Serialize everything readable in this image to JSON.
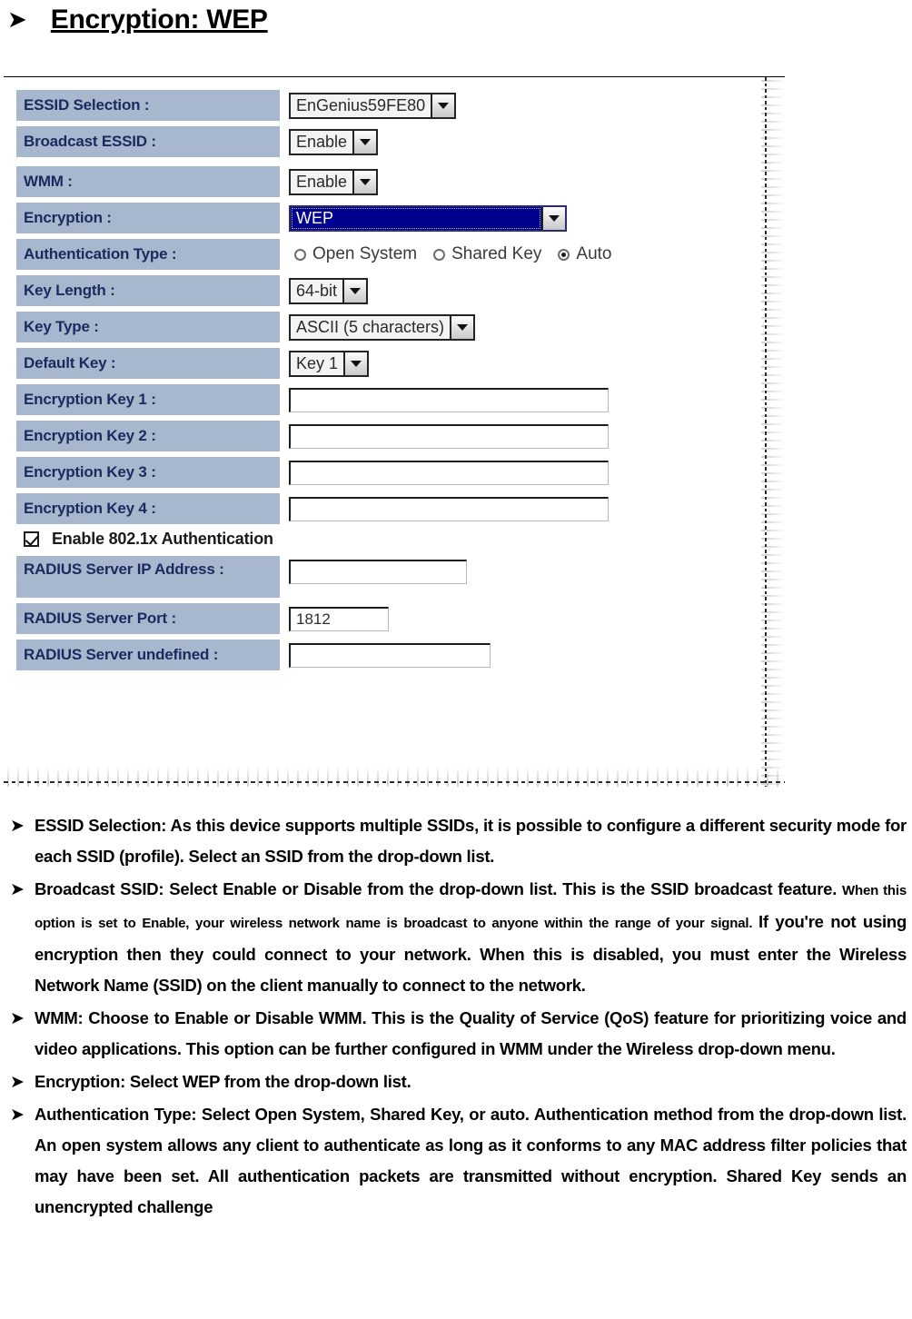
{
  "heading": {
    "bullet": "➤",
    "text": "Encryption: WEP"
  },
  "screenshot": {
    "rows": [
      {
        "label": "ESSID Selection :",
        "control": "select",
        "value": "EnGenius59FE80"
      },
      {
        "label": "Broadcast ESSID :",
        "control": "select",
        "value": "Enable"
      },
      {
        "label": "WMM :",
        "control": "select",
        "value": "Enable"
      },
      {
        "label": "Encryption :",
        "control": "select-focused",
        "value": "WEP"
      },
      {
        "label": "Authentication Type :",
        "control": "radio-group"
      },
      {
        "label": "Key Length :",
        "control": "select",
        "value": "64-bit"
      },
      {
        "label": "Key Type :",
        "control": "select",
        "value": "ASCII (5 characters)"
      },
      {
        "label": "Default Key :",
        "control": "select",
        "value": "Key 1"
      },
      {
        "label": "Encryption Key 1 :",
        "control": "text",
        "value": ""
      },
      {
        "label": "Encryption Key 2 :",
        "control": "text",
        "value": ""
      },
      {
        "label": "Encryption Key 3 :",
        "control": "text",
        "value": ""
      },
      {
        "label": "Encryption Key 4 :",
        "control": "text",
        "value": ""
      },
      {
        "label": "RADIUS Server IP Address :",
        "control": "text",
        "value": ""
      },
      {
        "label": "RADIUS Server Port :",
        "control": "text",
        "value": "1812"
      },
      {
        "label": "RADIUS Server undefined :",
        "control": "text",
        "value": ""
      }
    ],
    "auth_radios": [
      {
        "label": "Open System",
        "selected": false
      },
      {
        "label": "Shared Key",
        "selected": false
      },
      {
        "label": "Auto",
        "selected": true
      }
    ],
    "dot1x_checkbox": {
      "label": "Enable 802.1x Authentication",
      "checked": true
    },
    "labels": {
      "essid_selection": "ESSID Selection :",
      "broadcast_essid": "Broadcast ESSID :",
      "wmm": "WMM :",
      "encryption": "Encryption :",
      "authentication_type": "Authentication Type :",
      "key_length": "Key Length :",
      "key_type": "Key Type :",
      "default_key": "Default Key :",
      "enc_key_1": "Encryption Key 1 :",
      "enc_key_2": "Encryption Key 2 :",
      "enc_key_3": "Encryption Key 3 :",
      "enc_key_4": "Encryption Key 4 :",
      "radius_ip": "RADIUS Server IP Address :",
      "radius_port": "RADIUS Server Port :",
      "radius_undefined": "RADIUS Server undefined :"
    },
    "values": {
      "essid_selection": "EnGenius59FE80",
      "broadcast_essid": "Enable",
      "wmm": "Enable",
      "encryption": "WEP",
      "key_length": "64-bit",
      "key_type": "ASCII (5 characters)",
      "default_key": "Key 1",
      "enc_key_1": "",
      "enc_key_2": "",
      "enc_key_3": "",
      "enc_key_4": "",
      "radius_ip": "",
      "radius_port": "1812",
      "radius_undefined": ""
    }
  },
  "bullets": [
    {
      "arrow": "➤",
      "parts": [
        {
          "size": "normal",
          "text": "ESSID Selection: As this device supports multiple SSIDs, it is possible to configure a different security mode for each SSID (profile). Select an SSID from the drop-down list."
        }
      ]
    },
    {
      "arrow": "➤",
      "parts": [
        {
          "size": "normal",
          "text": "Broadcast SSID: Select Enable or Disable from the drop-down list. This is the SSID broadcast feature. "
        },
        {
          "size": "small",
          "text": "When this option is set to Enable, your wireless network name is broadcast to anyone within the range of your signal. "
        },
        {
          "size": "normal",
          "text": "If you're not using encryption then they could connect to your network. When this is disabled, you must enter the Wireless Network Name (SSID) on the client manually to connect to the network."
        }
      ]
    },
    {
      "arrow": "➤",
      "parts": [
        {
          "size": "normal",
          "text": "WMM: Choose to Enable or Disable WMM. This is the Quality of Service (QoS) feature for prioritizing voice and video applications. This option can be further configured in WMM under the Wireless drop-down menu."
        }
      ]
    },
    {
      "arrow": "➤",
      "parts": [
        {
          "size": "normal",
          "text": "Encryption: Select WEP from the drop-down list."
        }
      ]
    },
    {
      "arrow": "➤",
      "parts": [
        {
          "size": "normal",
          "text": "Authentication Type: Select Open System, Shared Key, or auto. Authentication method from the drop-down list. An open system allows any client to authenticate as long as it conforms to any MAC address filter policies that may have been set. All authentication packets are transmitted without encryption. Shared Key sends an unencrypted challenge"
        }
      ]
    }
  ],
  "colors": {
    "label_cell_bg": "#a7b7ce",
    "label_text": "#1b2a5e",
    "focused_select_bg": "#00008f",
    "focused_select_text": "#ffffff"
  }
}
